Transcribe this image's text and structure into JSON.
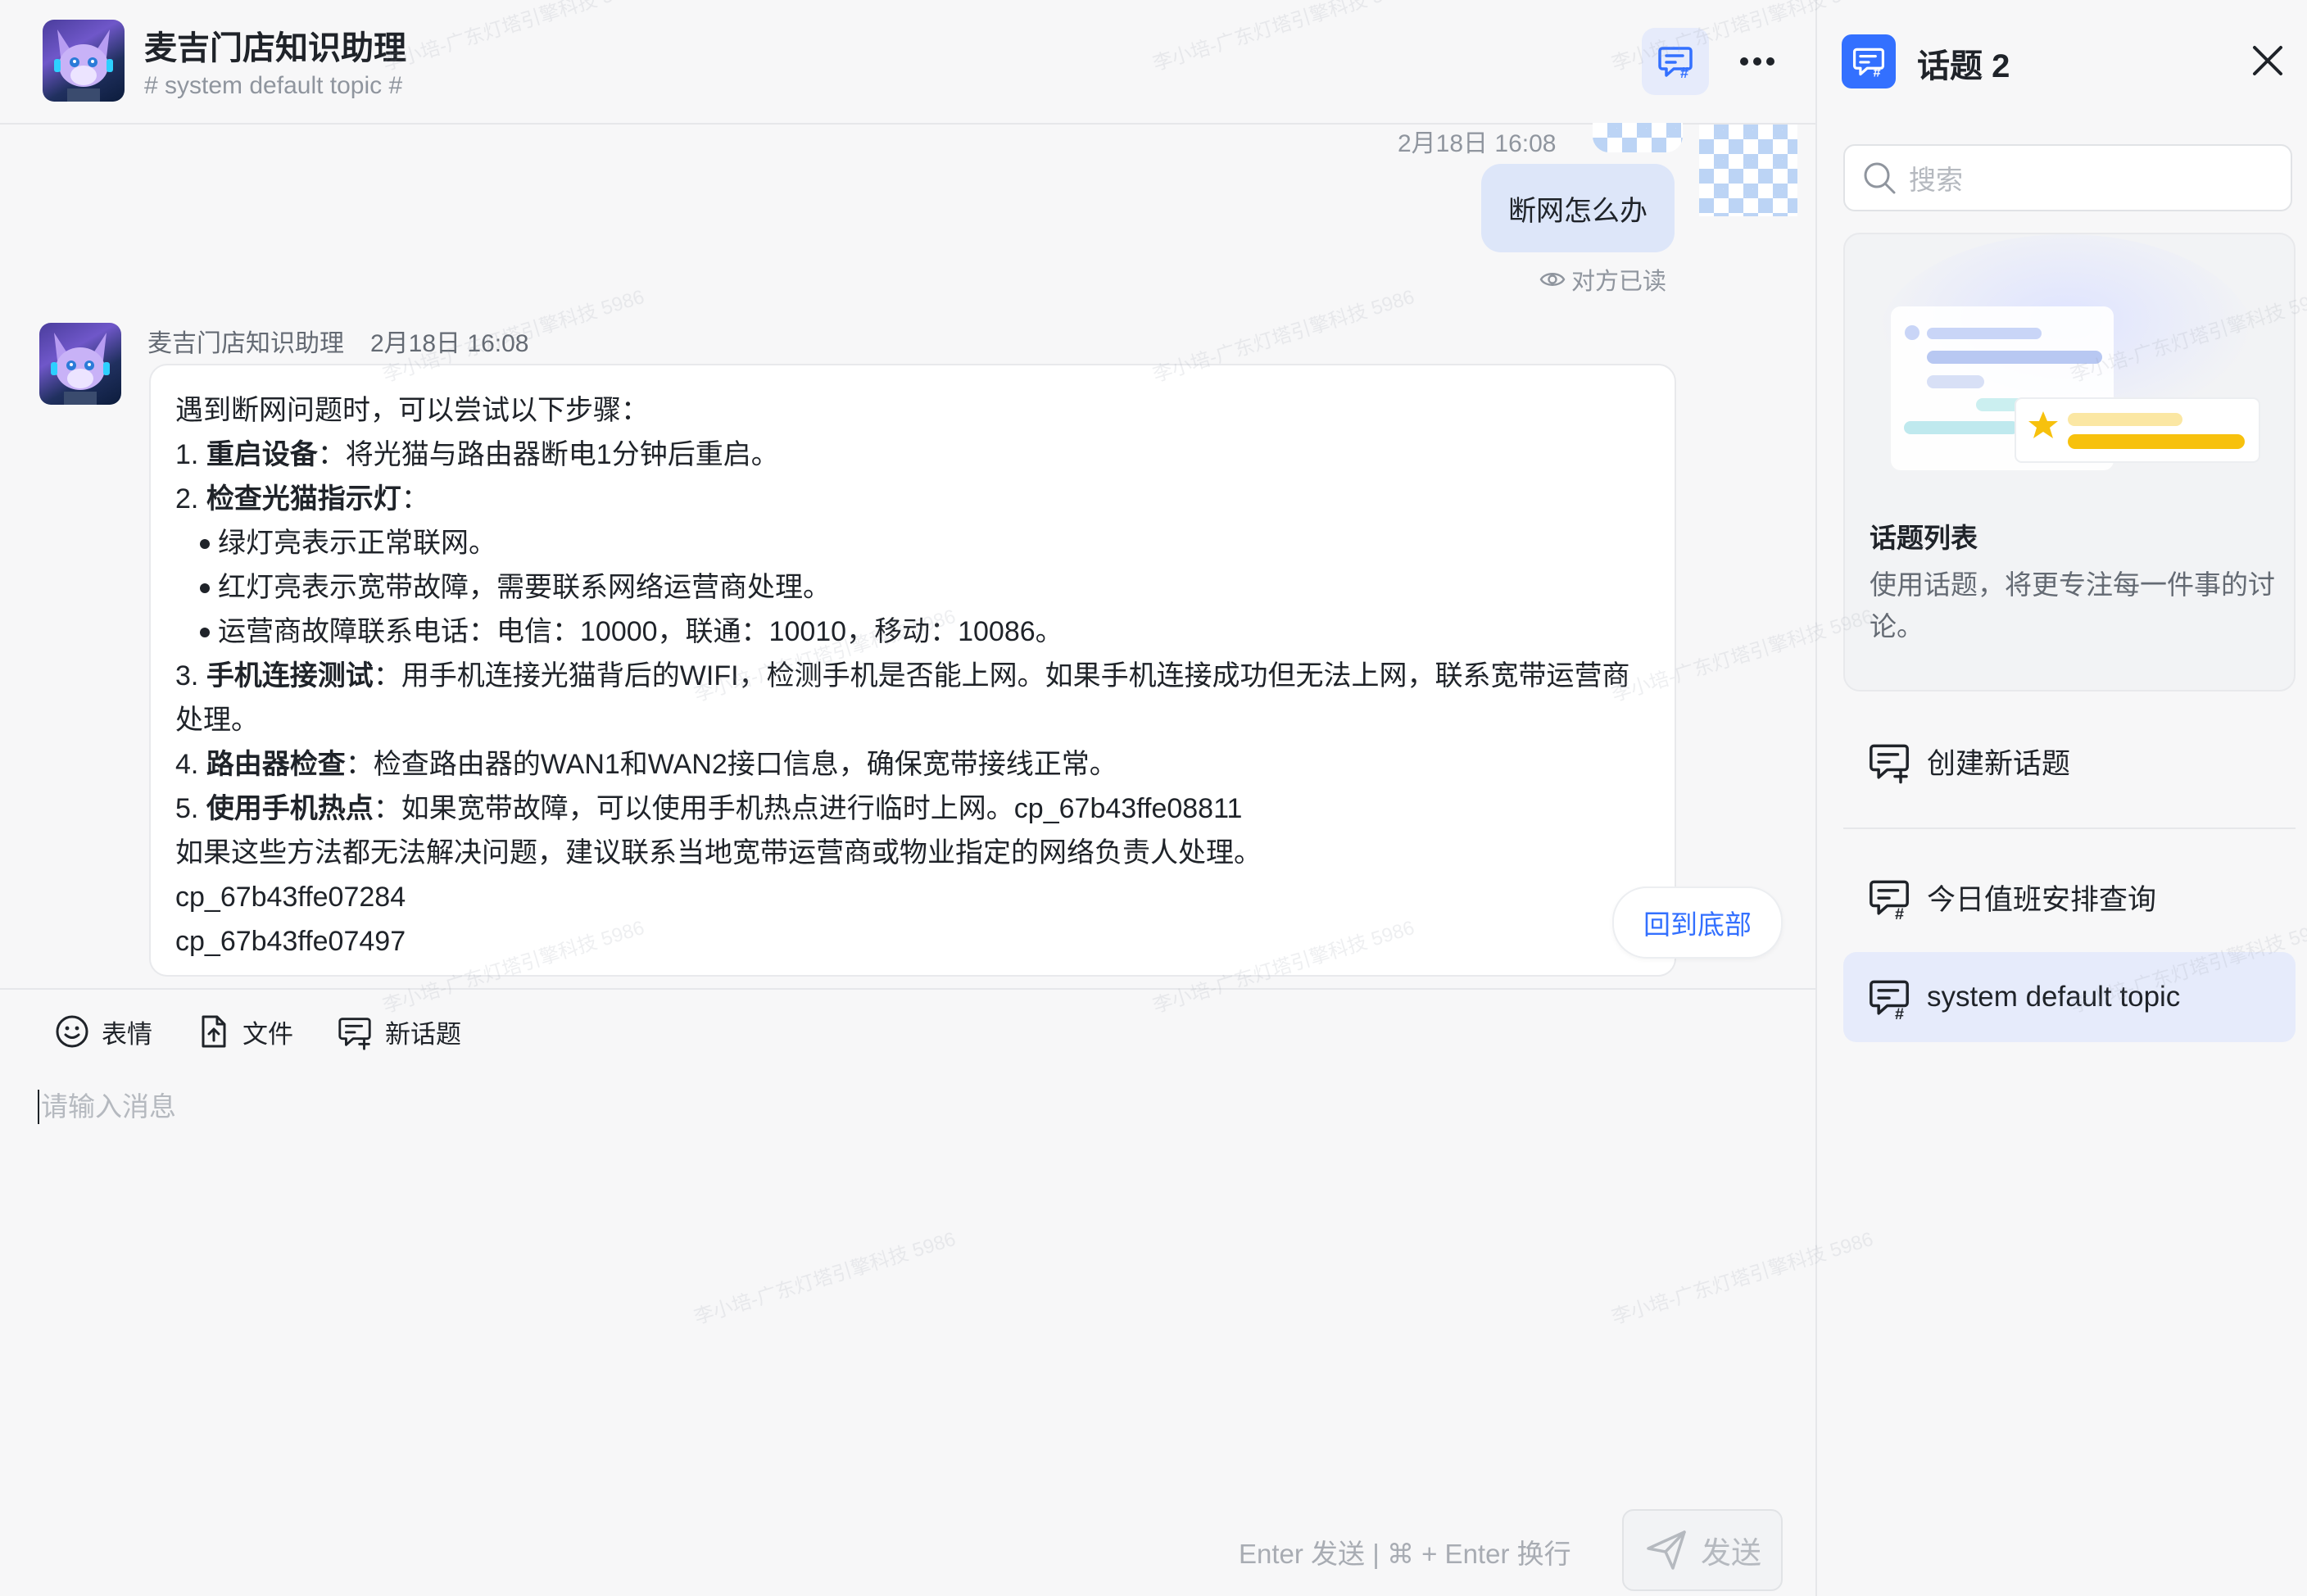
{
  "header": {
    "title": "麦吉门店知识助理",
    "subtitle": "# system default topic #"
  },
  "user_message": {
    "time": "2月18日 16:08",
    "text": "断网怎么办",
    "read_status": "对方已读"
  },
  "bot_message": {
    "name": "麦吉门店知识助理",
    "time": "2月18日 16:08",
    "intro": "遇到断网问题时，可以尝试以下步骤：",
    "s1_num": "1. ",
    "s1_bold": "重启设备",
    "s1_text": "：将光猫与路由器断电1分钟后重启。",
    "s2_num": "2. ",
    "s2_bold": "检查光猫指示灯",
    "s2_text": "：",
    "bullets": [
      "绿灯亮表示正常联网。",
      "红灯亮表示宽带故障，需要联系网络运营商处理。",
      "运营商故障联系电话：电信：10000，联通：10010，移动：10086。"
    ],
    "s3_num": "3. ",
    "s3_bold": "手机连接测试",
    "s3_text": "：用手机连接光猫背后的WIFI，检测手机是否能上网。如果手机连接成功但无法上网，联系宽带运营商处理。",
    "s4_num": "4. ",
    "s4_bold": "路由器检查",
    "s4_text": "：检查路由器的WAN1和WAN2接口信息，确保宽带接线正常。",
    "s5_num": "5. ",
    "s5_bold": "使用手机热点",
    "s5_text": "：如果宽带故障，可以使用手机热点进行临时上网。cp_67b43ffe08811",
    "closing": "如果这些方法都无法解决问题，建议联系当地宽带运营商或物业指定的网络负责人处理。",
    "ref1": "cp_67b43ffe07284",
    "ref2": "cp_67b43ffe07497"
  },
  "scroll_to_bottom_label": "回到底部",
  "toolbar": {
    "emoji_label": "表情",
    "file_label": "文件",
    "new_topic_label": "新话题"
  },
  "input": {
    "placeholder": "请输入消息"
  },
  "send": {
    "hint": "Enter 发送 | ⌘ + Enter 换行",
    "label": "发送"
  },
  "sidebar": {
    "title": "话题 2",
    "search_placeholder": "搜索",
    "card_title": "话题列表",
    "card_desc": "使用话题，将更专注每一件事的讨论。",
    "create_label": "创建新话题",
    "topics": [
      {
        "label": "今日值班安排查询",
        "active": false
      },
      {
        "label": "system default topic",
        "active": true
      }
    ]
  },
  "watermark": "李小培-广东灯塔引擎科技 5986",
  "colors": {
    "accent": "#3370ff",
    "active_bg": "#e6ebfb",
    "user_bubble": "#dde6f9",
    "text_muted": "#8f959e"
  }
}
